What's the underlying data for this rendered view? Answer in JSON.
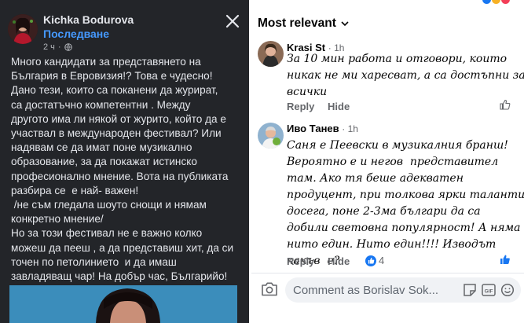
{
  "post": {
    "author": "Kichka Bodurova",
    "follow_label": "Последване",
    "time": "2 ч",
    "text_lines": [
      "Много кандидати за представянето на",
      "България в Евровизия!? Това е чудесно!",
      "Дано тези, които са поканени да журират,",
      "са достатъчно компетентни . Между",
      "другото има ли някой от журито, който да е",
      "участвал в международен фестивал? Или",
      "надявам се да имат поне музикално",
      "образование, за да покажат истинско",
      "професионално мнение. Вота на публиката",
      "разбира се  е най- важен!",
      " /не съм гледала шоуто снощи и нямам",
      "конкретно мнение/",
      "Но за този фестивал не е важно колко",
      "можеш да пееш , а да представиш хит, да си",
      "точен по петолинието  и да имаш",
      "завладяващ чар! На добър час, Българийо!"
    ]
  },
  "comments_panel": {
    "sort_label": "Most relevant",
    "comments": [
      {
        "author": "Krasi St",
        "time": "1h",
        "text_lines": [
          "За 10 мин работа и отговори, които",
          "никак не ми харесват, а са достъпни за",
          "всички"
        ],
        "reply_label": "Reply",
        "hide_label": "Hide"
      },
      {
        "author": "Иво Танев",
        "time": "1h",
        "text_lines": [
          "Саня е Пеевски в музикалния бранш!",
          "Вероятно е и негов  представител",
          "там. Ако тя беше адекватен",
          "продуцент, при толкова ярки таланти,",
          "досега, поне 2-3ма българи да са",
          "добили световна популярност! А няма",
          "нито един. Нито един!!!! Изводът",
          "какъв  е?"
        ],
        "reply_label": "Reply",
        "hide_label": "Hide",
        "reaction_count": "4"
      }
    ],
    "input_placeholder": "Comment as Borislav Sok...",
    "gif_label": "GIF"
  },
  "colors": {
    "post_bg": "#232529",
    "link_blue": "#4599ff",
    "fb_blue": "#1877f2"
  }
}
